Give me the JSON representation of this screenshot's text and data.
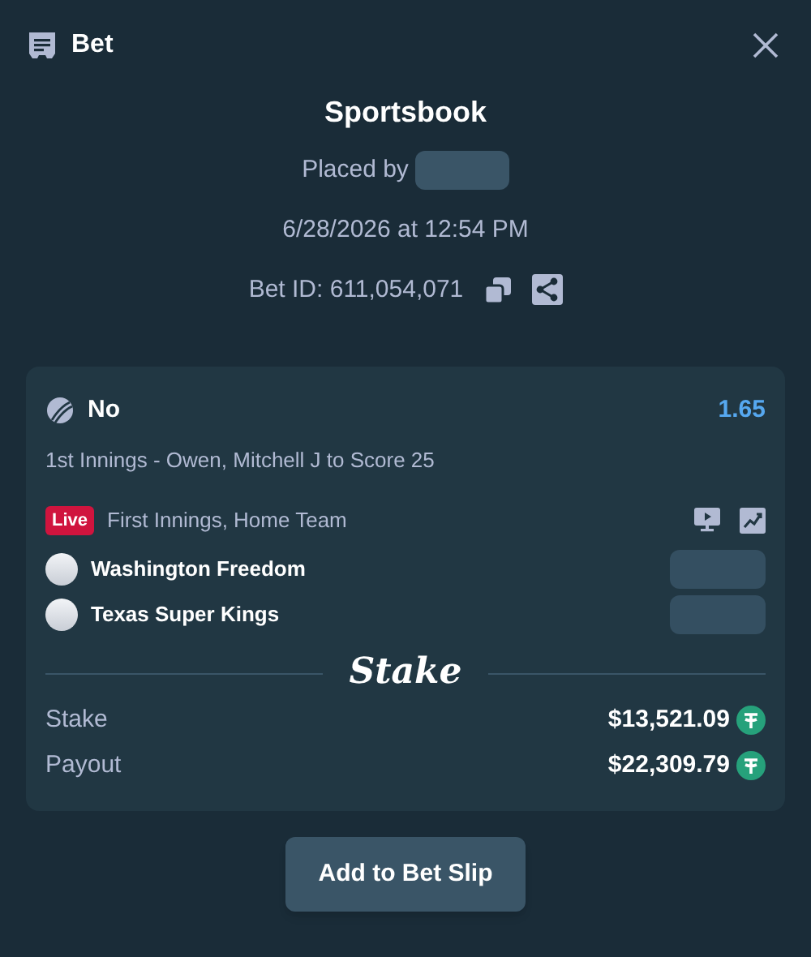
{
  "header": {
    "title": "Bet"
  },
  "summary": {
    "title": "Sportsbook",
    "placed_by": "Placed by",
    "date": "6/28/2026 at 12:54 PM",
    "bet_id": "Bet ID: 611,054,071"
  },
  "selection": {
    "outcome": "No",
    "odds": "1.65",
    "market": "1st Innings - Owen, Mitchell J to Score 25",
    "live": true,
    "live_label": "Live",
    "event": "First Innings, Home Team",
    "teams": [
      {
        "name": "Washington Freedom"
      },
      {
        "name": "Texas Super Kings"
      }
    ]
  },
  "logo": "Stake",
  "amounts": [
    {
      "label": "Stake",
      "value": "$13,521.09"
    },
    {
      "label": "Payout",
      "value": "$22,309.79"
    }
  ],
  "button": "Add to Bet Slip"
}
